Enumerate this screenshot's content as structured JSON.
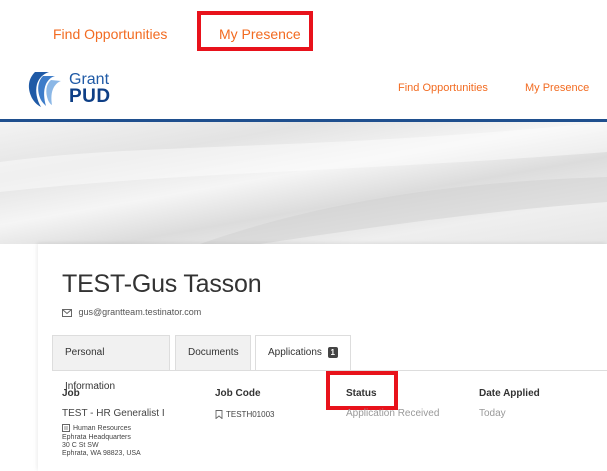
{
  "top_nav": {
    "find_opportunities": "Find Opportunities",
    "my_presence": "My Presence"
  },
  "header": {
    "logo_grant": "Grant",
    "logo_pud": "PUD",
    "nav_find": "Find Opportunities",
    "nav_presence": "My Presence"
  },
  "profile": {
    "name": "TEST-Gus Tasson",
    "email": "gus@grantteam.testinator.com"
  },
  "tabs": [
    {
      "label": "Personal Information"
    },
    {
      "label": "Documents"
    },
    {
      "label": "Applications",
      "badge": "1"
    }
  ],
  "table": {
    "headers": {
      "job": "Job",
      "job_code": "Job Code",
      "status": "Status",
      "date_applied": "Date Applied"
    },
    "rows": [
      {
        "job": "TEST - HR Generalist I",
        "department": "Human Resources",
        "location_name": "Ephrata Headquarters",
        "address_line1": "30 C St SW",
        "address_line2": "Ephrata, WA 98823, USA",
        "job_code": "TESTH01003",
        "status": "Application Received",
        "date_applied": "Today"
      }
    ]
  },
  "colors": {
    "accent_orange": "#f26b21",
    "brand_blue": "#1f4f8e",
    "highlight_red": "#e8121b"
  }
}
